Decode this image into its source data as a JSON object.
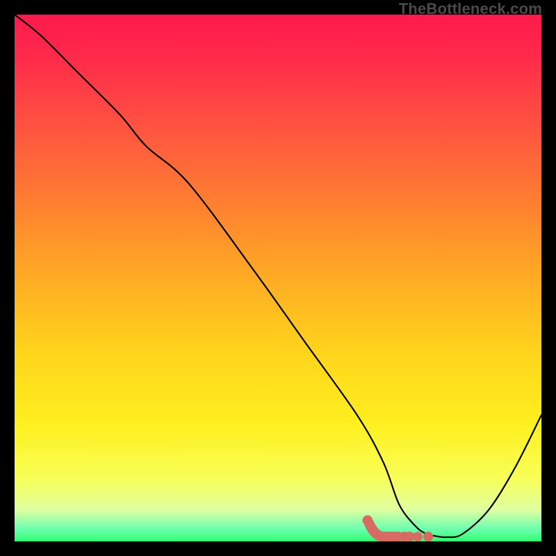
{
  "watermark": "TheBottleneck.com",
  "chart_data": {
    "type": "line",
    "title": "",
    "xlabel": "",
    "ylabel": "",
    "xlim": [
      0,
      100
    ],
    "ylim": [
      0,
      100
    ],
    "series": [
      {
        "name": "bottleneck-curve",
        "x": [
          0,
          5,
          12,
          20,
          25,
          33,
          45,
          55,
          65,
          70,
          73,
          76,
          78,
          80,
          82,
          85,
          90,
          95,
          100
        ],
        "y": [
          100,
          96,
          89,
          81,
          75,
          68,
          52,
          38,
          24,
          15,
          7,
          3,
          1.5,
          1,
          0.8,
          1.4,
          6,
          14,
          24
        ],
        "color": "#000000"
      }
    ],
    "markers": {
      "name": "highlight-cluster",
      "color": "#d76a63",
      "points": [
        {
          "x": 67.0,
          "y": 4.0,
          "r": 2.2
        },
        {
          "x": 67.3,
          "y": 3.4,
          "r": 2.2
        },
        {
          "x": 67.6,
          "y": 2.8,
          "r": 2.2
        },
        {
          "x": 67.9,
          "y": 2.3,
          "r": 2.2
        },
        {
          "x": 68.2,
          "y": 1.9,
          "r": 2.2
        },
        {
          "x": 68.5,
          "y": 1.6,
          "r": 2.2
        },
        {
          "x": 68.8,
          "y": 1.3,
          "r": 2.2
        },
        {
          "x": 69.1,
          "y": 1.1,
          "r": 2.2
        },
        {
          "x": 69.4,
          "y": 1.0,
          "r": 2.2
        },
        {
          "x": 69.8,
          "y": 0.9,
          "r": 2.2
        },
        {
          "x": 70.3,
          "y": 0.9,
          "r": 2.2
        },
        {
          "x": 70.9,
          "y": 0.9,
          "r": 2.2
        },
        {
          "x": 71.5,
          "y": 0.9,
          "r": 2.2
        },
        {
          "x": 72.1,
          "y": 0.9,
          "r": 2.2
        },
        {
          "x": 72.8,
          "y": 0.9,
          "r": 2.2
        },
        {
          "x": 74.0,
          "y": 0.9,
          "r": 2.0
        },
        {
          "x": 75.0,
          "y": 0.9,
          "r": 2.0
        },
        {
          "x": 76.5,
          "y": 0.9,
          "r": 1.8
        },
        {
          "x": 78.5,
          "y": 0.9,
          "r": 2.0
        }
      ]
    }
  }
}
